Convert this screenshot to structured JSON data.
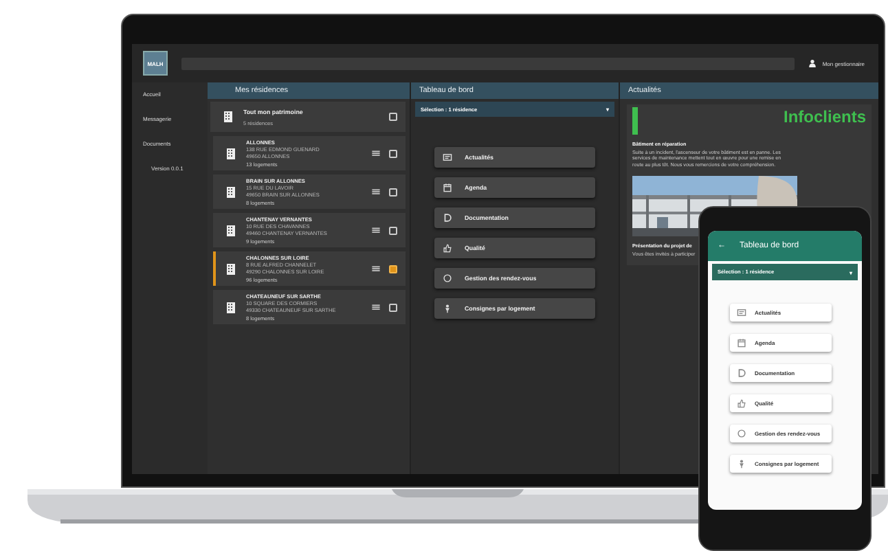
{
  "laptop": {
    "logo": "MALH",
    "user": "Mon gestionnaire",
    "sidebar": [
      {
        "label": "Accueil"
      },
      {
        "label": "Messagerie"
      },
      {
        "label": "Documents"
      }
    ],
    "version": "Version 0.0.1",
    "residences": {
      "title": "Mes résidences",
      "all": {
        "name": "Tout mon patrimoine",
        "count": "5 résidences",
        "selected": false
      },
      "items": [
        {
          "name": "ALLONNES",
          "street": "138 RUE EDMOND GUENARD",
          "city": "49650 ALLONNES",
          "units": "13 logements",
          "selected": false
        },
        {
          "name": "BRAIN SUR ALLONNES",
          "street": "15 RUE DU LAVOIR",
          "city": "49650 BRAIN SUR ALLONNES",
          "units": "8 logements",
          "selected": false
        },
        {
          "name": "CHANTENAY VERNANTES",
          "street": "10 RUE DES CHAVANNES",
          "city": "49460 CHANTENAY VERNANTES",
          "units": "9 logements",
          "selected": false
        },
        {
          "name": "CHALONNES SUR LOIRE",
          "street": "8 RUE ALFRED CHANNELET",
          "city": "49290 CHALONNES SUR LOIRE",
          "units": "96 logements",
          "selected": true
        },
        {
          "name": "CHATEAUNEUF SUR SARTHE",
          "street": "10 SQUARE DES CORMIERS",
          "city": "49330 CHATEAUNEUF SUR SARTHE",
          "units": "8 logements",
          "selected": false
        }
      ]
    },
    "dashboard": {
      "title": "Tableau de bord",
      "selection": "Sélection : 1 résidence",
      "caret": "▾",
      "buttons": [
        "Actualités",
        "Agenda",
        "Documentation",
        "Qualité",
        "Gestion des rendez-vous",
        "Consignes par logement"
      ]
    },
    "news": {
      "title": "Actualités",
      "brand": "Infoclients",
      "items": [
        {
          "heading": "Bâtiment en réparation",
          "body": "Suite à un incident, l'ascenseur de votre bâtiment est en panne. Les services de maintenance mettent tout en œuvre pour une remise en route au plus tôt. Nous vous remercions de votre compréhension."
        },
        {
          "heading": "Présentation du projet de",
          "body": "Vous êtes invités à participer"
        }
      ]
    }
  },
  "phone": {
    "back": "←",
    "title": "Tableau de bord",
    "selection": "Sélection : 1 résidence",
    "caret": "▾",
    "buttons": [
      "Actualités",
      "Agenda",
      "Documentation",
      "Qualité",
      "Gestion des rendez-vous",
      "Consignes par logement"
    ]
  }
}
